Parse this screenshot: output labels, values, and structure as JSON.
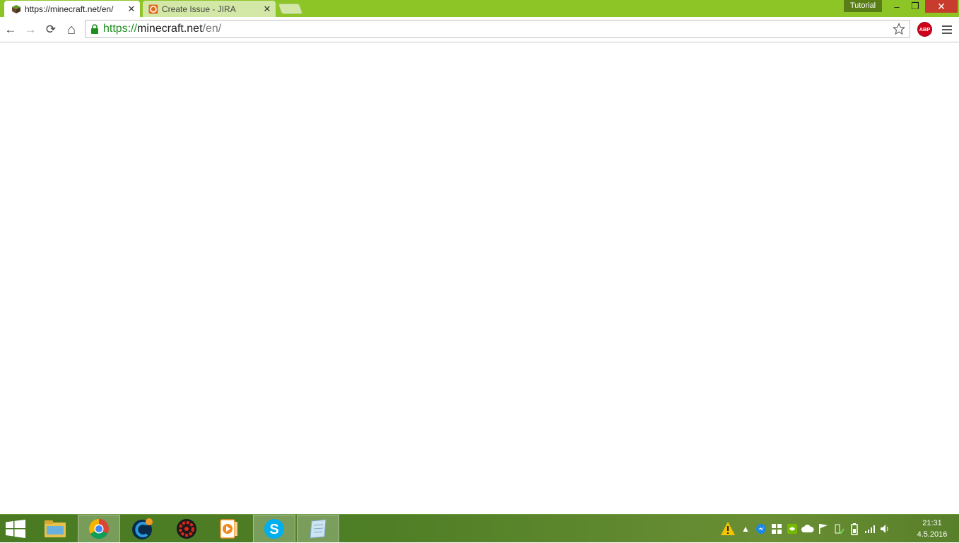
{
  "tabs": [
    {
      "title": "https://minecraft.net/en/",
      "active": true,
      "favicon": "minecraft-grass-block-icon"
    },
    {
      "title": "Create Issue - JIRA",
      "active": false,
      "favicon": "jira-icon"
    }
  ],
  "profile_badge": "Tutorial",
  "window_controls": {
    "minimize": "–",
    "maximize": "❐",
    "close": "✕"
  },
  "toolbar": {
    "back": "←",
    "forward": "→",
    "reload": "⟳",
    "home": "⌂",
    "url": {
      "scheme": "https://",
      "host": "minecraft.net",
      "path": "/en/"
    },
    "abp_label": "ABP"
  },
  "taskbar": {
    "apps": [
      {
        "name": "file-explorer",
        "running": false
      },
      {
        "name": "chrome",
        "running": true
      },
      {
        "name": "ccleaner-like",
        "running": false
      },
      {
        "name": "red-security-app",
        "running": false
      },
      {
        "name": "media-player",
        "running": false
      },
      {
        "name": "skype",
        "running": true
      },
      {
        "name": "notepad",
        "running": true
      }
    ],
    "clock": {
      "time": "21:31",
      "date": "4.5.2016"
    }
  },
  "colors": {
    "chrome_frame": "#8dc426",
    "secure_scheme": "#1e8e1e",
    "taskbar": "#4f7e26"
  }
}
